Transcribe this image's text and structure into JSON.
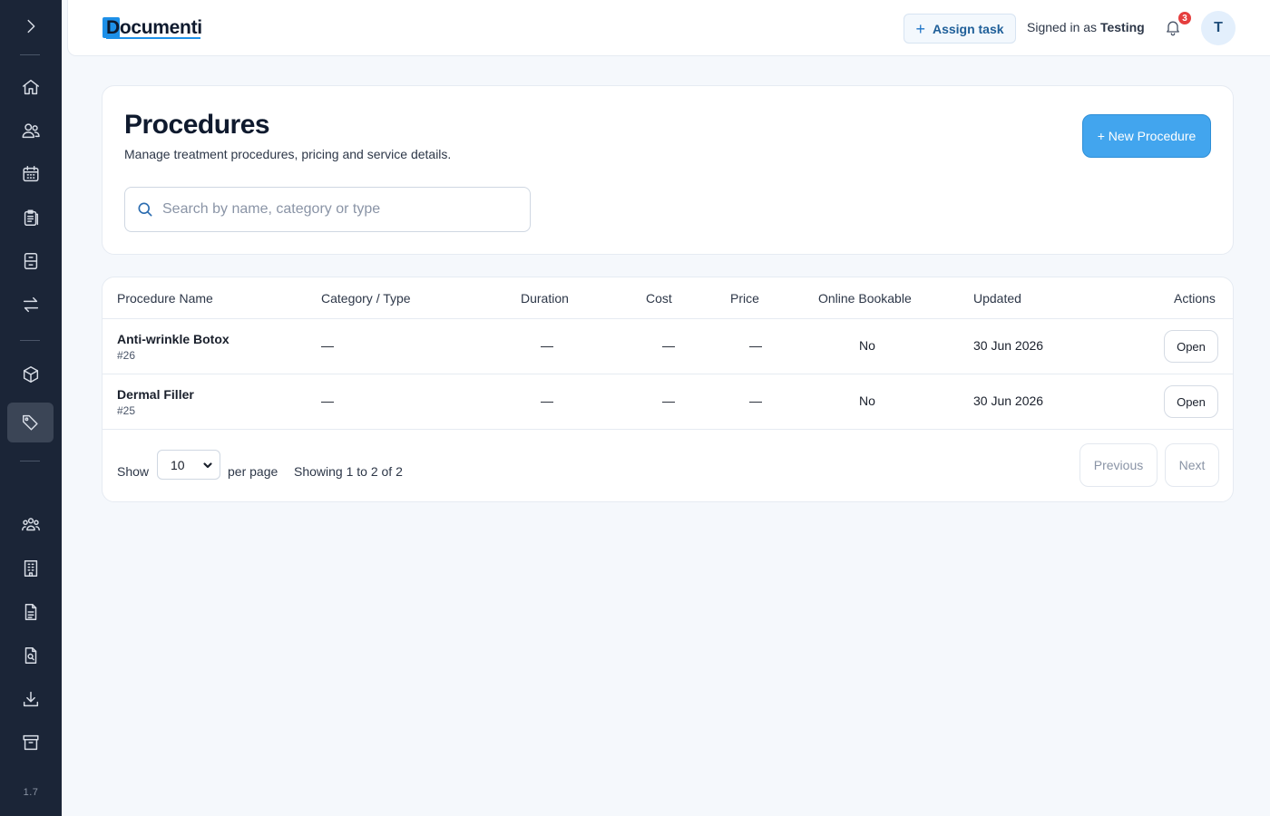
{
  "sidebar": {
    "expand_icon": "chevron-right-icon",
    "items": [
      {
        "name": "home",
        "icon": "home-icon"
      },
      {
        "name": "patients",
        "icon": "users-icon"
      },
      {
        "name": "calendar",
        "icon": "calendar-icon"
      },
      {
        "name": "clipboard",
        "icon": "clipboard-icon"
      },
      {
        "name": "records",
        "icon": "file-cabinet-icon"
      },
      {
        "name": "transfers",
        "icon": "transfer-arrows-icon"
      },
      {
        "name": "inventory",
        "icon": "cube-icon"
      },
      {
        "name": "procedures",
        "icon": "tag-icon",
        "active": true
      },
      {
        "name": "team",
        "icon": "team-icon"
      },
      {
        "name": "buildings",
        "icon": "building-icon"
      },
      {
        "name": "documents",
        "icon": "document-icon"
      },
      {
        "name": "document-search",
        "icon": "document-search-icon"
      },
      {
        "name": "downloads",
        "icon": "download-icon"
      },
      {
        "name": "archive",
        "icon": "archive-icon"
      }
    ],
    "version": "1.7"
  },
  "topbar": {
    "logo_text": "Documenti",
    "assign_task_label": "Assign task",
    "signed_in_prefix": "Signed in as",
    "signed_in_user": "Testing",
    "notification_count": "3",
    "avatar_initial": "T"
  },
  "header": {
    "title": "Procedures",
    "subtitle": "Manage treatment procedures, pricing and service details.",
    "new_button_label": "+ New Procedure",
    "search_placeholder": "Search by name, category or type",
    "search_value": ""
  },
  "table": {
    "columns": {
      "name": "Procedure Name",
      "category": "Category / Type",
      "duration": "Duration",
      "cost": "Cost",
      "price": "Price",
      "online": "Online Bookable",
      "updated": "Updated",
      "actions": "Actions"
    },
    "rows": [
      {
        "name": "Anti-wrinkle Botox",
        "id": "#26",
        "category": "—",
        "duration": "—",
        "cost": "—",
        "price": "—",
        "online": "No",
        "updated": "30 Jun 2026",
        "action": "Open"
      },
      {
        "name": "Dermal Filler",
        "id": "#25",
        "category": "—",
        "duration": "—",
        "cost": "—",
        "price": "—",
        "online": "No",
        "updated": "30 Jun 2026",
        "action": "Open"
      }
    ]
  },
  "pagination": {
    "show_label": "Show",
    "per_page_value": "10",
    "per_page_label": "per page",
    "showing_text": "Showing 1 to 2 of 2",
    "previous_label": "Previous",
    "next_label": "Next"
  },
  "colors": {
    "sidebar_bg": "#1b2537",
    "accent": "#42a5ee",
    "badge": "#e53e3e"
  }
}
